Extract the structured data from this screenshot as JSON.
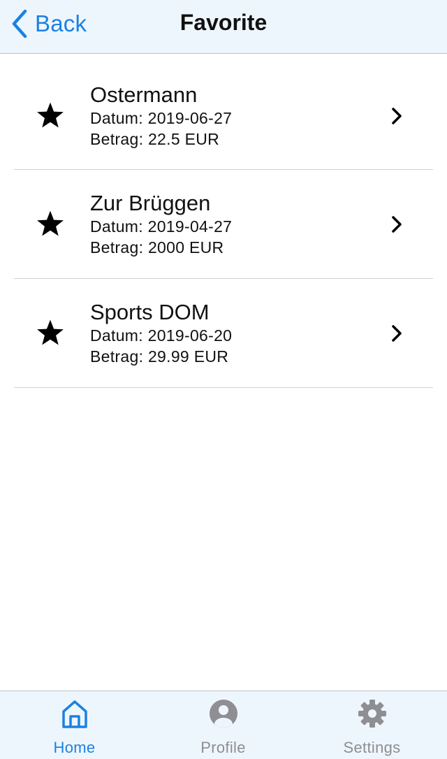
{
  "header": {
    "back_label": "Back",
    "title": "Favorite"
  },
  "favorites": [
    {
      "name": "Ostermann",
      "date_line": "Datum: 2019-06-27",
      "amount_line": "Betrag: 22.5 EUR"
    },
    {
      "name": "Zur Brüggen",
      "date_line": "Datum: 2019-04-27",
      "amount_line": "Betrag: 2000 EUR"
    },
    {
      "name": "Sports DOM",
      "date_line": "Datum: 2019-06-20",
      "amount_line": "Betrag: 29.99 EUR"
    }
  ],
  "tabbar": {
    "tabs": [
      {
        "label": "Home",
        "icon": "home-icon",
        "active": true
      },
      {
        "label": "Profile",
        "icon": "user-circle-icon",
        "active": false
      },
      {
        "label": "Settings",
        "icon": "gear-icon",
        "active": false
      }
    ]
  },
  "colors": {
    "accent": "#1a82e2",
    "inactive": "#8e8e93",
    "bar_background": "#eef6fd",
    "divider": "#cfcfcf"
  }
}
